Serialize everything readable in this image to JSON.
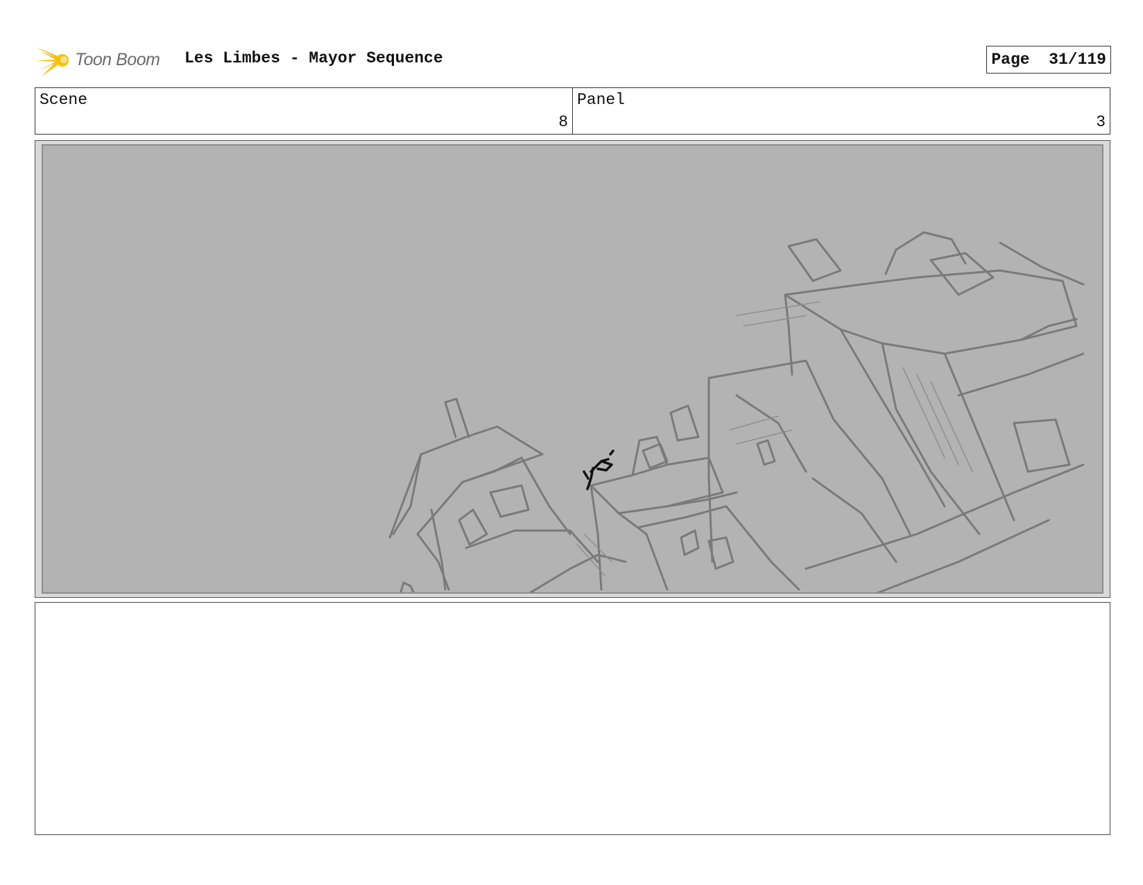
{
  "header": {
    "logo_text": "Toon Boom",
    "title": "Les Limbes - Mayor Sequence",
    "page_label": "Page",
    "page_value": "31/119"
  },
  "scene": {
    "label": "Scene",
    "value": "8"
  },
  "panel": {
    "label": "Panel",
    "value": "3"
  },
  "colors": {
    "logo_yellow": "#f2c21b",
    "sketch_background": "#b3b3b3",
    "sketch_lines": "#7a7a7a",
    "figure": "#111111"
  },
  "notes": {
    "text": ""
  }
}
